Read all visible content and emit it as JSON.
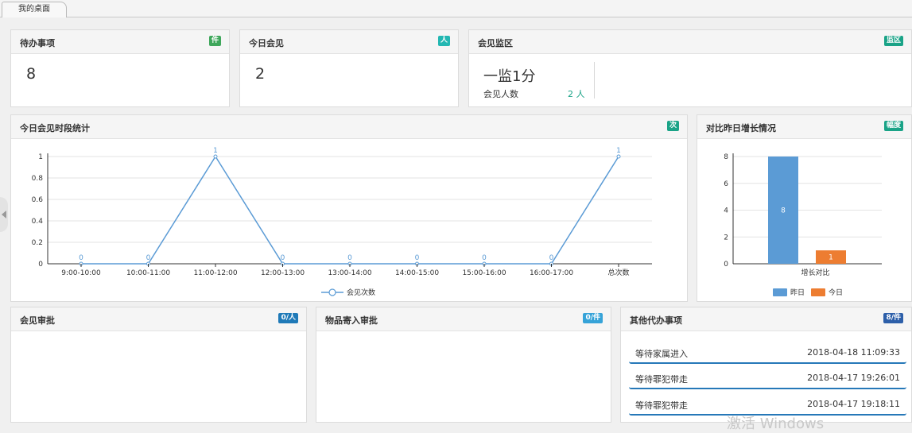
{
  "tab": {
    "label": "我的桌面"
  },
  "pending": {
    "title": "待办事项",
    "badge": "件",
    "value": "8"
  },
  "today_meet": {
    "title": "今日会见",
    "badge": "人",
    "value": "2"
  },
  "monitor": {
    "title": "会见监区",
    "badge": "监区",
    "zone": "一监1分",
    "count_label": "会见人数",
    "count": "2 人"
  },
  "time_chart": {
    "title": "今日会见时段统计",
    "badge": "次"
  },
  "growth": {
    "title": "对比昨日增长情况",
    "badge": "幅度"
  },
  "approve": {
    "title": "会见审批",
    "badge": "0/人"
  },
  "goods": {
    "title": "物品寄入审批",
    "badge": "0/件"
  },
  "other": {
    "title": "其他代办事项",
    "badge": "8/件",
    "items": [
      {
        "text": "等待家属进入",
        "time": "2018-04-18 11:09:33"
      },
      {
        "text": "等待罪犯带走",
        "time": "2018-04-17 19:26:01"
      },
      {
        "text": "等待罪犯带走",
        "time": "2018-04-17 19:18:11"
      }
    ]
  },
  "watermark": "激活 Windows",
  "chart_data": [
    {
      "type": "line",
      "categories": [
        "9:00-10:00",
        "10:00-11:00",
        "11:00-12:00",
        "12:00-13:00",
        "13:00-14:00",
        "14:00-15:00",
        "15:00-16:00",
        "16:00-17:00",
        "总次数"
      ],
      "series": [
        {
          "name": "会见次数",
          "values": [
            0,
            0,
            1,
            0,
            0,
            0,
            0,
            0,
            1
          ]
        }
      ],
      "yticks": [
        "0",
        "0.2",
        "0.4",
        "0.6",
        "0.8",
        "1"
      ],
      "ylim": [
        0,
        1
      ],
      "legend": "bottom-center",
      "color": "#5b9bd5"
    },
    {
      "type": "bar",
      "categories": [
        "增长对比"
      ],
      "series": [
        {
          "name": "昨日",
          "values": [
            8
          ],
          "color": "#5b9bd5"
        },
        {
          "name": "今日",
          "values": [
            1
          ],
          "color": "#ed7d31"
        }
      ],
      "yticks": [
        "0",
        "2",
        "4",
        "6",
        "8"
      ],
      "ylim": [
        0,
        8
      ],
      "legend": "bottom-center"
    }
  ]
}
